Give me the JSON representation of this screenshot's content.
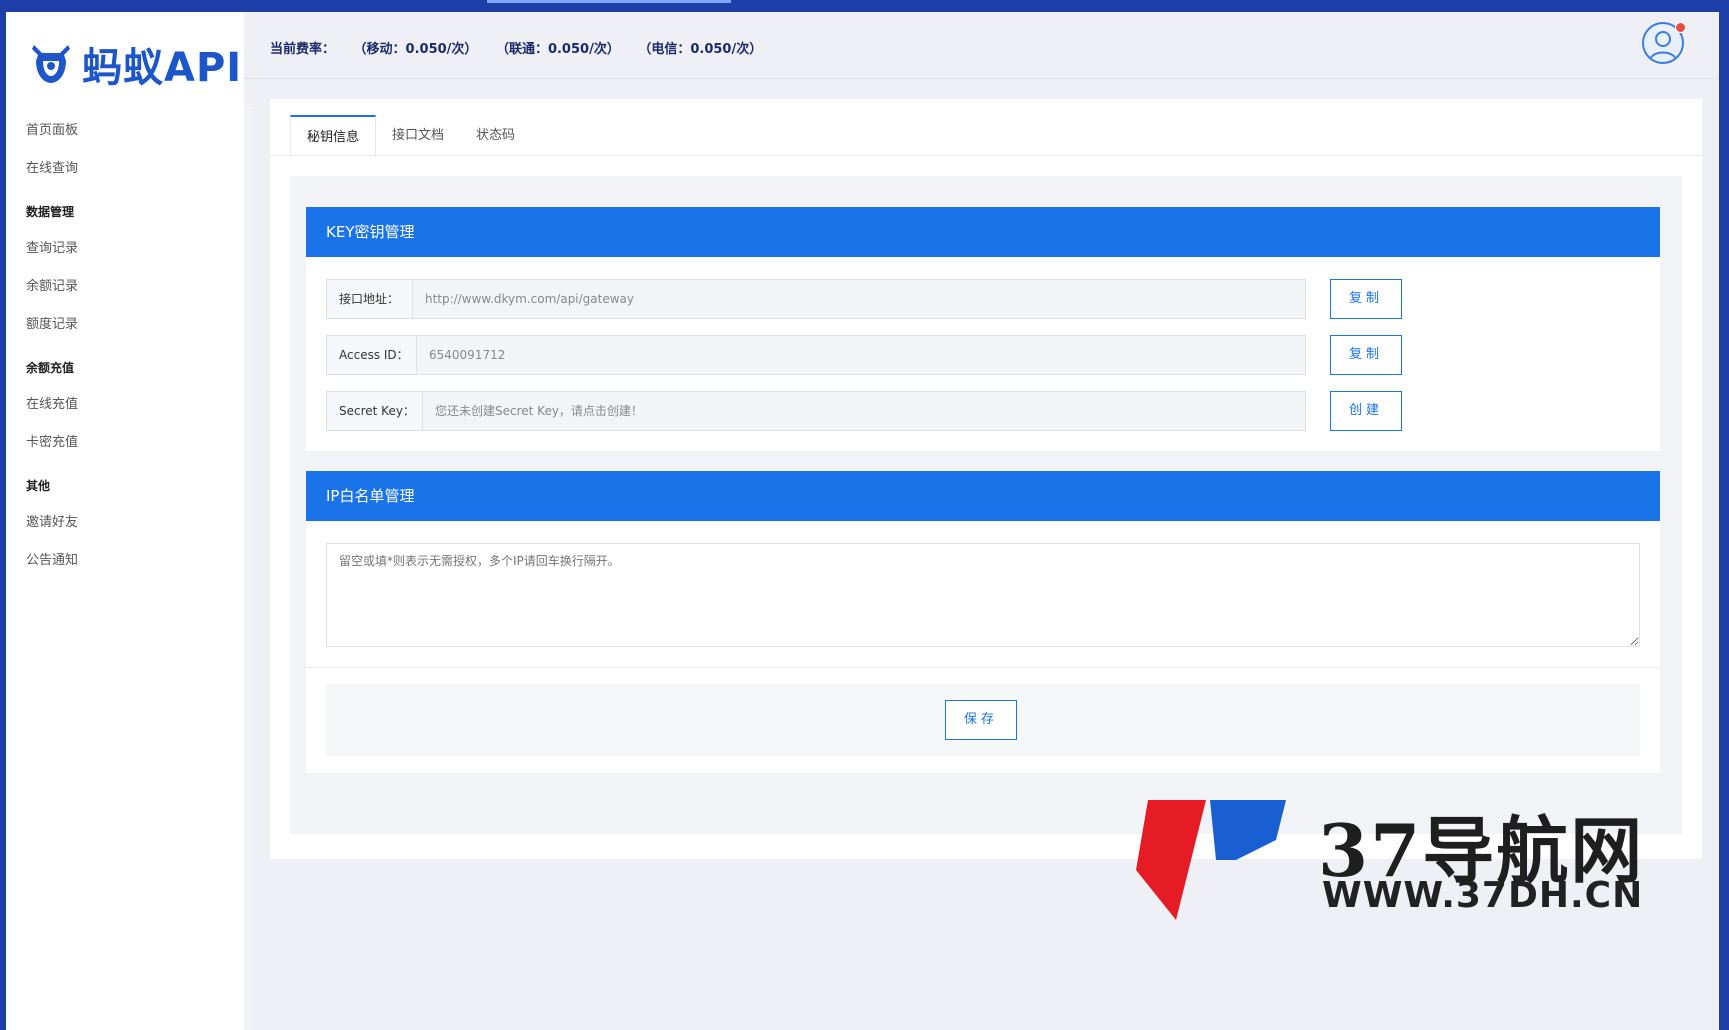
{
  "brand": {
    "logo_text": "蚂蚁API",
    "color": "#1d56c8"
  },
  "header": {
    "rate_label": "当前费率：",
    "rates": [
      "（移动：0.050/次）",
      "（联通：0.050/次）",
      "（电信：0.050/次）"
    ]
  },
  "sidebar": {
    "items": [
      {
        "type": "item",
        "label": "首页面板"
      },
      {
        "type": "item",
        "label": "在线查询"
      },
      {
        "type": "group",
        "label": "数据管理"
      },
      {
        "type": "item",
        "label": "查询记录"
      },
      {
        "type": "item",
        "label": "余额记录"
      },
      {
        "type": "item",
        "label": "额度记录"
      },
      {
        "type": "group",
        "label": "余额充值"
      },
      {
        "type": "item",
        "label": "在线充值"
      },
      {
        "type": "item",
        "label": "卡密充值"
      },
      {
        "type": "group",
        "label": "其他"
      },
      {
        "type": "item",
        "label": "邀请好友"
      },
      {
        "type": "item",
        "label": "公告通知"
      }
    ]
  },
  "tabs": [
    {
      "label": "秘钥信息",
      "active": true
    },
    {
      "label": "接口文档",
      "active": false
    },
    {
      "label": "状态码",
      "active": false
    }
  ],
  "key_card": {
    "title": "KEY密钥管理",
    "rows": [
      {
        "label": "接口地址：",
        "value": "http://www.dkym.com/api/gateway",
        "button": "复制"
      },
      {
        "label": "Access ID：",
        "value": "6540091712",
        "button": "复制"
      },
      {
        "label": "Secret Key：",
        "value": "您还未创建Secret Key，请点击创建！",
        "button": "创建"
      }
    ]
  },
  "ip_card": {
    "title": "IP白名单管理",
    "placeholder": "留空或填*则表示无需授权，多个IP请回车换行隔开。",
    "save_label": "保存"
  },
  "watermark": {
    "title": "37导航网",
    "url": "WWW.37DH.CN"
  },
  "colors": {
    "primary": "#1a73e8",
    "frame": "#1f3fa8",
    "badge": "#e84b3c"
  }
}
